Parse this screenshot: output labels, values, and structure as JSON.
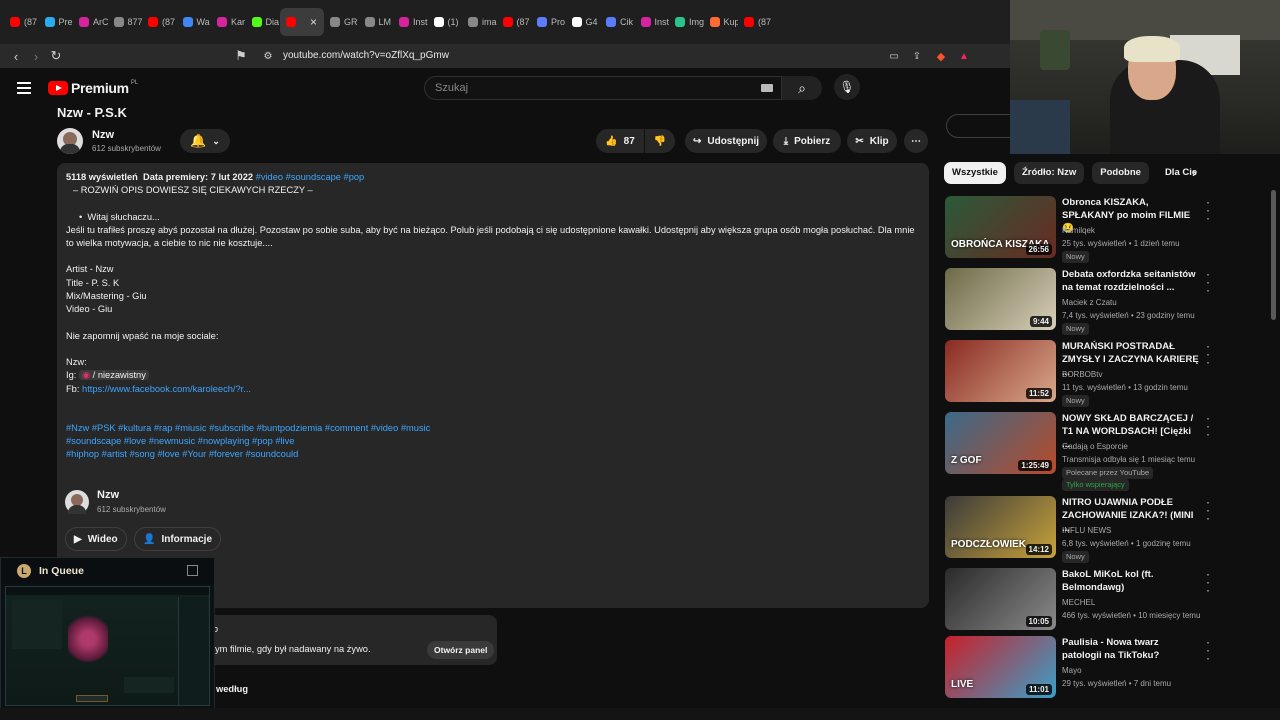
{
  "browser": {
    "tabs": [
      {
        "label": "(87",
        "color": "#ff0000"
      },
      {
        "label": "Pre",
        "color": "#2aabee"
      },
      {
        "label": "ArC",
        "color": "#d6249f"
      },
      {
        "label": "877",
        "color": "#888888"
      },
      {
        "label": "(87",
        "color": "#ff0000"
      },
      {
        "label": "Wa",
        "color": "#4285f4"
      },
      {
        "label": "Kar",
        "color": "#d6249f"
      },
      {
        "label": "Dia",
        "color": "#53fc18"
      },
      {
        "label": "",
        "color": "#ff0000"
      },
      {
        "label": "GR",
        "color": "#888888"
      },
      {
        "label": "LM",
        "color": "#888888"
      },
      {
        "label": "Inst",
        "color": "#d6249f"
      },
      {
        "label": "(1)",
        "color": "#ffffff"
      },
      {
        "label": "ima",
        "color": "#888888"
      },
      {
        "label": "(87",
        "color": "#ff0000"
      },
      {
        "label": "Pro",
        "color": "#5b7cff"
      },
      {
        "label": "G4",
        "color": "#ffffff"
      },
      {
        "label": "Cik",
        "color": "#5b7cff"
      },
      {
        "label": "Inst",
        "color": "#d6249f"
      },
      {
        "label": "Img",
        "color": "#27c48e"
      },
      {
        "label": "Kup",
        "color": "#ff6b35"
      },
      {
        "label": "(87",
        "color": "#ff0000"
      }
    ],
    "url": "youtube.com/watch?v=oZflXq_pGmw"
  },
  "header": {
    "logo_text": "Premium",
    "logo_region": "PL",
    "search_placeholder": "Szukaj"
  },
  "video": {
    "title": "Nzw - P.S.K",
    "channel": "Nzw",
    "subscribers": "612 subskrybentów",
    "likes": "87",
    "share_label": "Udostępnij",
    "download_label": "Pobierz",
    "clip_label": "Klip"
  },
  "description": {
    "stats": "5118 wyświetleń  Data premiery: 7 lut 2022",
    "stats_tags": "#video #soundscape #pop",
    "line1": "– ROZWIŃ OPIS DOWIESZ SIĘ CIEKAWYCH RZECZY –",
    "bullet": "Witaj słuchaczu...",
    "para1": "Jeśli tu trafiłeś proszę abyś pozostał na dłużej. Pozostaw po sobie suba, aby być na bieżąco. Polub jeśli podobają ci się udostępnione kawałki. Udostępnij aby większa grupa osób mogła posłuchać. Dla mnie",
    "para2": "to wielka motywacja, a ciebie to nic nie kosztuje....",
    "credits": [
      "Artist - Nzw",
      "Title - P. S. K",
      "Mix/Mastering - Giu",
      "Video - Giu"
    ],
    "social_intro": "Nie zapomnij wpaść na moje sociale:",
    "social_name": "Nzw:",
    "ig_label": "Ig:",
    "ig_handle": "/ niezawistny",
    "fb_label": "Fb:",
    "fb_link": "https://www.facebook.com/karoleech/?r...",
    "hashtags1": "#Nzw #PSK #kultura #rap #miusic #subscribe #buntpodziemia #comment #video #music",
    "hashtags2": "#soundscape #love #newmusic #nowplaying #pop #live",
    "hashtags3": "#hiphop #artist #song #love #Your #forever #soundcould"
  },
  "channel_card": {
    "name": "Nzw",
    "subscribers": "612 subskrybentów",
    "videos_btn": "Wideo",
    "about_btn": "Informacje"
  },
  "chat": {
    "prefix": "o",
    "text": "ym filmie, gdy był nadawany na żywo.",
    "button": "Otwórz panel"
  },
  "sort_label": "według",
  "overlay": {
    "title": "In Queue"
  },
  "sidebar": {
    "chips": [
      "Wszystkie",
      "Źródło: Nzw",
      "Podobne",
      "Dla Cie"
    ],
    "videos": [
      {
        "title": "Obronca KISZAKA, SPŁAKANY po moim FILMIE 😢",
        "channel": "Kamilqek",
        "meta": "25 tys. wyświetleń • 1 dzień temu",
        "badge": "Nowy",
        "duration": "26:56",
        "thumb_text": "OBROŃCA KISZAKA",
        "c1": "#2a5a3a",
        "c2": "#6a2a22"
      },
      {
        "title": "Debata oxfordzka seitanistów na temat rozdzielności ...",
        "channel": "Maciek z Czatu",
        "meta": "7,4 tys. wyświetleń • 23 godziny temu",
        "badge": "Nowy",
        "duration": "9:44",
        "thumb_text": "",
        "c1": "#6d6a48",
        "c2": "#d8cfb8"
      },
      {
        "title": "MURAŃSKI POSTRADAŁ ZMYSŁY I ZACZYNA KARIERĘ ...",
        "channel": "BORBOBtv",
        "meta": "11 tys. wyświetleń • 13 godzin temu",
        "badge": "Nowy",
        "duration": "11:52",
        "thumb_text": "",
        "c1": "#8a2a22",
        "c2": "#d9a98a"
      },
      {
        "title": "NOWY SKŁAD BARCZĄCEJ / T1 NA WORLDSACH! [Ciężki ...",
        "channel": "Gadają o Esporcie",
        "meta": "Transmisja odbyła się 1 miesiąc temu",
        "badge": "Polecane przez YouTube",
        "badge2": "Tylko wspierający",
        "duration": "1:25:49",
        "thumb_text": "Z GOF",
        "c1": "#3a6a8a",
        "c2": "#b84a2a"
      },
      {
        "title": "NITRO UJAWNIA PODŁE ZACHOWANIE IZAKA?! (MINI ...",
        "channel": "INFLU NEWS",
        "meta": "6,8 tys. wyświetleń • 1 godzinę temu",
        "badge": "Nowy",
        "duration": "14:12",
        "thumb_text": "PODCZŁOWIEK",
        "c1": "#3a3a3a",
        "c2": "#c8a23a"
      },
      {
        "title": "BakoL MiKoL kol (ft. Belmondawg)",
        "channel": "MECHEL",
        "meta": "466 tys. wyświetleń • 10 miesięcy temu",
        "badge": "",
        "duration": "10:05",
        "thumb_text": "",
        "c1": "#2a2a2a",
        "c2": "#8a8a8a"
      },
      {
        "title": "Paulisia - Nowa twarz patologii na TikToku?",
        "channel": "Mayo",
        "meta": "29 tys. wyświetleń • 7 dni temu",
        "badge": "",
        "duration": "11:01",
        "thumb_text": "LIVE",
        "c1": "#c8202a",
        "c2": "#3aa0c8"
      }
    ]
  }
}
